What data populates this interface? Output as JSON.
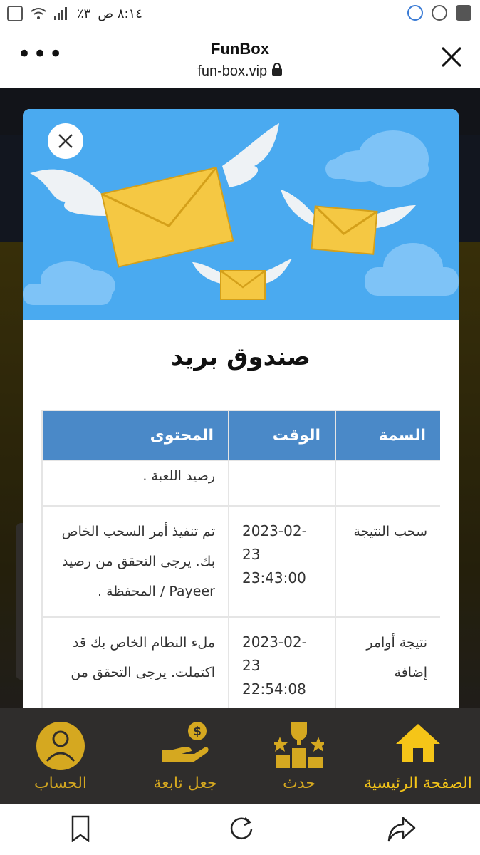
{
  "status_bar": {
    "time": "٨:١٤ ص",
    "battery": "٣٪"
  },
  "browser": {
    "title": "FunBox",
    "url": "fun-box.vip",
    "menu_glyph": "•••"
  },
  "mailbox": {
    "title": "صندوق بريد",
    "headers": {
      "type": "السمة",
      "time": "الوقت",
      "content": "المحتوى"
    },
    "partial_row": {
      "content": "رصيد اللعبة ."
    },
    "rows": [
      {
        "type": "سحب النتيجة",
        "time": "2023-02-23 23:43:00",
        "content": "تم تنفيذ أمر السحب الخاص بك. يرجى التحقق من رصيد Payeer / المحفظة ."
      },
      {
        "type": "نتيجة أوامر إضافة",
        "time": "2023-02-23 22:54:08",
        "content": "ملء النظام الخاص بك قد اكتملت. يرجى التحقق من"
      }
    ]
  },
  "bottom_nav": [
    {
      "label": "الصفحة الرئيسية",
      "icon": "home-icon",
      "active": true
    },
    {
      "label": "حدث",
      "icon": "trophy-icon",
      "active": false
    },
    {
      "label": "جعل تابعة",
      "icon": "money-hand-icon",
      "active": false
    },
    {
      "label": "الحساب",
      "icon": "account-icon",
      "active": false
    }
  ],
  "colors": {
    "accent": "#f5c518",
    "header_blue": "#4a89c8",
    "banner_blue": "#4aaaf0"
  }
}
